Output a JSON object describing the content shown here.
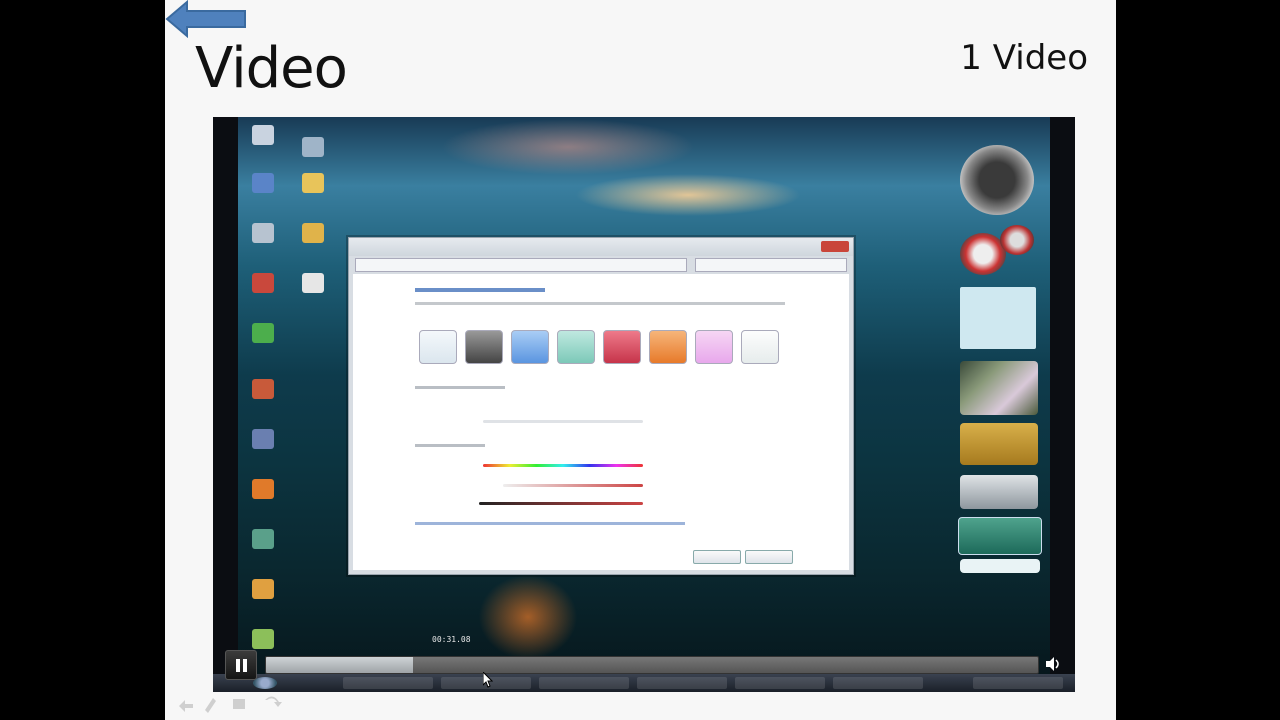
{
  "slide": {
    "title": "Video",
    "counter": "1 Video",
    "back_icon": "left-arrow-icon",
    "accent_color": "#4f81bd"
  },
  "player": {
    "timestamp": "00:31.08",
    "progress_fraction": 0.19,
    "pause_icon": "pause-icon",
    "volume_icon": "speaker-icon"
  }
}
